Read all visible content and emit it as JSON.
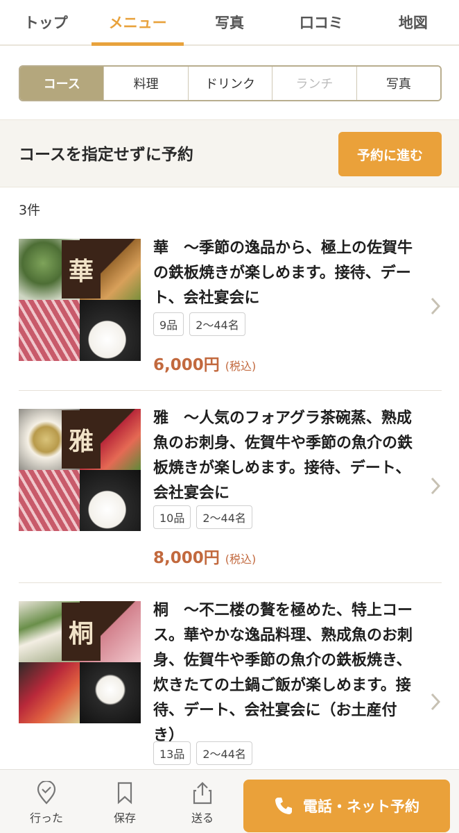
{
  "top_tabs": [
    {
      "label": "トップ"
    },
    {
      "label": "メニュー"
    },
    {
      "label": "写真"
    },
    {
      "label": "口コミ"
    },
    {
      "label": "地図"
    }
  ],
  "active_top_tab": "メニュー",
  "sub_tabs": [
    {
      "label": "コース"
    },
    {
      "label": "料理"
    },
    {
      "label": "ドリンク"
    },
    {
      "label": "ランチ"
    },
    {
      "label": "写真"
    }
  ],
  "reserve_banner": {
    "text": "コースを指定せずに予約",
    "button": "予約に進む"
  },
  "count_label": "3件",
  "courses": [
    {
      "title": "華　〜季節の逸品から、極上の佐賀牛の鉄板焼きが楽しめます。接待、デート、会社宴会に",
      "badge_char": "華",
      "items": "9品",
      "people": "2〜44名",
      "price": "6,000円",
      "tax": "(税込)"
    },
    {
      "title": "雅　〜人気のフォアグラ茶碗蒸、熟成魚のお刺身、佐賀牛や季節の魚介の鉄板焼きが楽しめます。接待、デート、会社宴会に",
      "badge_char": "雅",
      "items": "10品",
      "people": "2〜44名",
      "price": "8,000円",
      "tax": "(税込)"
    },
    {
      "title": "桐　〜不二楼の贅を極めた、特上コース。華やかな逸品料理、熟成魚のお刺身、佐賀牛や季節の魚介の鉄板焼き、炊きたての土鍋ご飯が楽しめます。接待、デート、会社宴会に（お土産付き）",
      "badge_char": "桐",
      "items": "13品",
      "people": "2〜44名"
    }
  ],
  "bottom_bar": {
    "went_label": "行った",
    "save_label": "保存",
    "send_label": "送る",
    "call_label": "電話・ネット予約"
  },
  "colors": {
    "accent": "#eaa13a",
    "segment_active": "#b4a77d",
    "price": "#c2693e"
  }
}
